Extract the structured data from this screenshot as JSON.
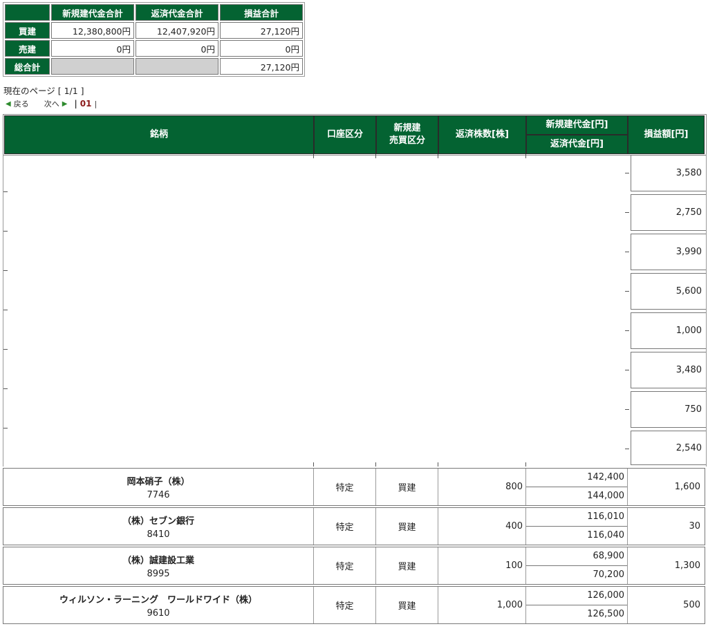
{
  "summary": {
    "headers": [
      "新規建代金合計",
      "返済代金合計",
      "損益合計"
    ],
    "rows": [
      {
        "label": "買建",
        "new_total": "12,380,800円",
        "close_total": "12,407,920円",
        "pl": "27,120円"
      },
      {
        "label": "売建",
        "new_total": "0円",
        "close_total": "0円",
        "pl": "0円"
      },
      {
        "label": "総合計",
        "new_total": "",
        "close_total": "",
        "pl": "27,120円"
      }
    ]
  },
  "page_info": "現在のページ [ 1/1 ]",
  "pager": {
    "prev": "戻る",
    "next": "次へ",
    "page": "01"
  },
  "table": {
    "headers": {
      "name": "銘柄",
      "account": "口座区分",
      "side_line1": "新規建",
      "side_line2": "売買区分",
      "qty": "返済株数[株]",
      "new_amount": "新規建代金[円]",
      "close_amount": "返済代金[円]",
      "pl": "損益額[円]"
    },
    "blank_pl": [
      "3,580",
      "2,750",
      "3,990",
      "5,600",
      "1,000",
      "3,480",
      "750",
      "2,540"
    ],
    "rows": [
      {
        "name": "岡本硝子（株）",
        "code": "7746",
        "account": "特定",
        "side": "買建",
        "qty": "800",
        "new_amount": "142,400",
        "close_amount": "144,000",
        "pl": "1,600"
      },
      {
        "name": "（株）セブン銀行",
        "code": "8410",
        "account": "特定",
        "side": "買建",
        "qty": "400",
        "new_amount": "116,010",
        "close_amount": "116,040",
        "pl": "30"
      },
      {
        "name": "（株）誠建設工業",
        "code": "8995",
        "account": "特定",
        "side": "買建",
        "qty": "100",
        "new_amount": "68,900",
        "close_amount": "70,200",
        "pl": "1,300"
      },
      {
        "name": "ウィルソン・ラーニング　ワールドワイド（株）",
        "code": "9610",
        "account": "特定",
        "side": "買建",
        "qty": "1,000",
        "new_amount": "126,000",
        "close_amount": "126,500",
        "pl": "500"
      }
    ]
  }
}
